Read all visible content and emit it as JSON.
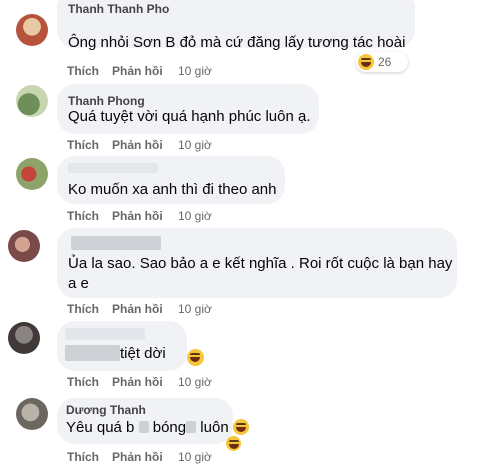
{
  "actions": {
    "like": "Thích",
    "reply": "Phản hồi",
    "time": "10 giờ"
  },
  "comments": [
    {
      "author": "Thanh Thanh Pho",
      "text": "Ông nhỏi Sơn B đỏ mà cứ đăng lấy tương tác hoài",
      "reaction_count": "26",
      "reaction_icon": "haha-emoji-icon"
    },
    {
      "author": "Thanh Phong",
      "text": "Quá tuyệt vời quá hạnh phúc luôn ạ."
    },
    {
      "text": "Ko muốn xa anh thì đi theo anh"
    },
    {
      "text_line1": "Ủa la sao. Sao bảo a e kết nghĩa . Roi rốt cuộc là bạn hay",
      "text_line2": "a e"
    },
    {
      "text": "tiệt dời"
    },
    {
      "author": "Dương Thanh",
      "text_a": "Yêu quá b",
      "text_b": "bóng",
      "text_c": "luôn"
    }
  ],
  "colors": {
    "bubble": "#f0f2f5",
    "meta": "#65676b",
    "emoji": "#f7c53a"
  }
}
